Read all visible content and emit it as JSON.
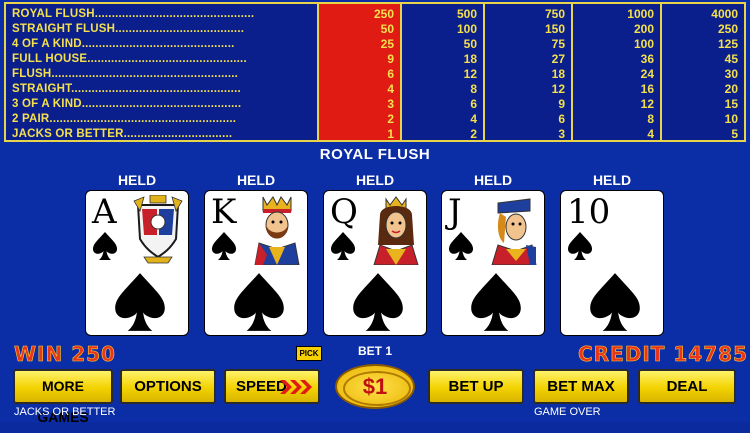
{
  "paytable": {
    "hands": [
      {
        "name": "ROYAL FLUSH",
        "dots": "...............................................",
        "values": [
          "250",
          "500",
          "750",
          "1000",
          "4000"
        ]
      },
      {
        "name": "STRAIGHT FLUSH",
        "dots": "......................................",
        "values": [
          "50",
          "100",
          "150",
          "200",
          "250"
        ]
      },
      {
        "name": "4 OF A KIND",
        "dots": ".............................................",
        "values": [
          "25",
          "50",
          "75",
          "100",
          "125"
        ]
      },
      {
        "name": "FULL HOUSE",
        "dots": "...............................................",
        "values": [
          "9",
          "18",
          "27",
          "36",
          "45"
        ]
      },
      {
        "name": "FLUSH",
        "dots": ".......................................................",
        "values": [
          "6",
          "12",
          "18",
          "24",
          "30"
        ]
      },
      {
        "name": "STRAIGHT",
        "dots": "..................................................",
        "values": [
          "4",
          "8",
          "12",
          "16",
          "20"
        ]
      },
      {
        "name": "3 OF A KIND",
        "dots": "...............................................",
        "values": [
          "3",
          "6",
          "9",
          "12",
          "15"
        ]
      },
      {
        "name": "2 PAIR",
        "dots": ".......................................................",
        "values": [
          "2",
          "4",
          "6",
          "8",
          "10"
        ]
      },
      {
        "name": "JACKS OR BETTER",
        "dots": "................................",
        "values": [
          "1",
          "2",
          "3",
          "4",
          "5"
        ]
      }
    ],
    "active_column": 0
  },
  "result_text": "ROYAL FLUSH",
  "cards": [
    {
      "held": "HELD",
      "rank": "A",
      "suit": "spade-icon",
      "face": "ace-crest"
    },
    {
      "held": "HELD",
      "rank": "K",
      "suit": "spade-icon",
      "face": "king"
    },
    {
      "held": "HELD",
      "rank": "Q",
      "suit": "spade-icon",
      "face": "queen"
    },
    {
      "held": "HELD",
      "rank": "J",
      "suit": "spade-icon",
      "face": "jack"
    },
    {
      "held": "HELD",
      "rank": "10",
      "suit": "spade-icon",
      "face": "none"
    }
  ],
  "status": {
    "win": "WIN 250",
    "credit": "CREDIT 14785",
    "pick": "PICK",
    "bet": "BET 1"
  },
  "buttons": {
    "more_games": "MORE GAMES",
    "options": "OPTIONS",
    "speed": "SPEED",
    "coin": "$1",
    "bet_up": "BET UP",
    "bet_max": "BET MAX",
    "deal": "DEAL"
  },
  "footer": {
    "game_name": "JACKS OR BETTER",
    "game_state": "GAME OVER"
  },
  "colors": {
    "background": "#0b2da6",
    "paytable_text": "#f4e04d",
    "active_column": "#e01b14",
    "button": "#f3d200"
  }
}
